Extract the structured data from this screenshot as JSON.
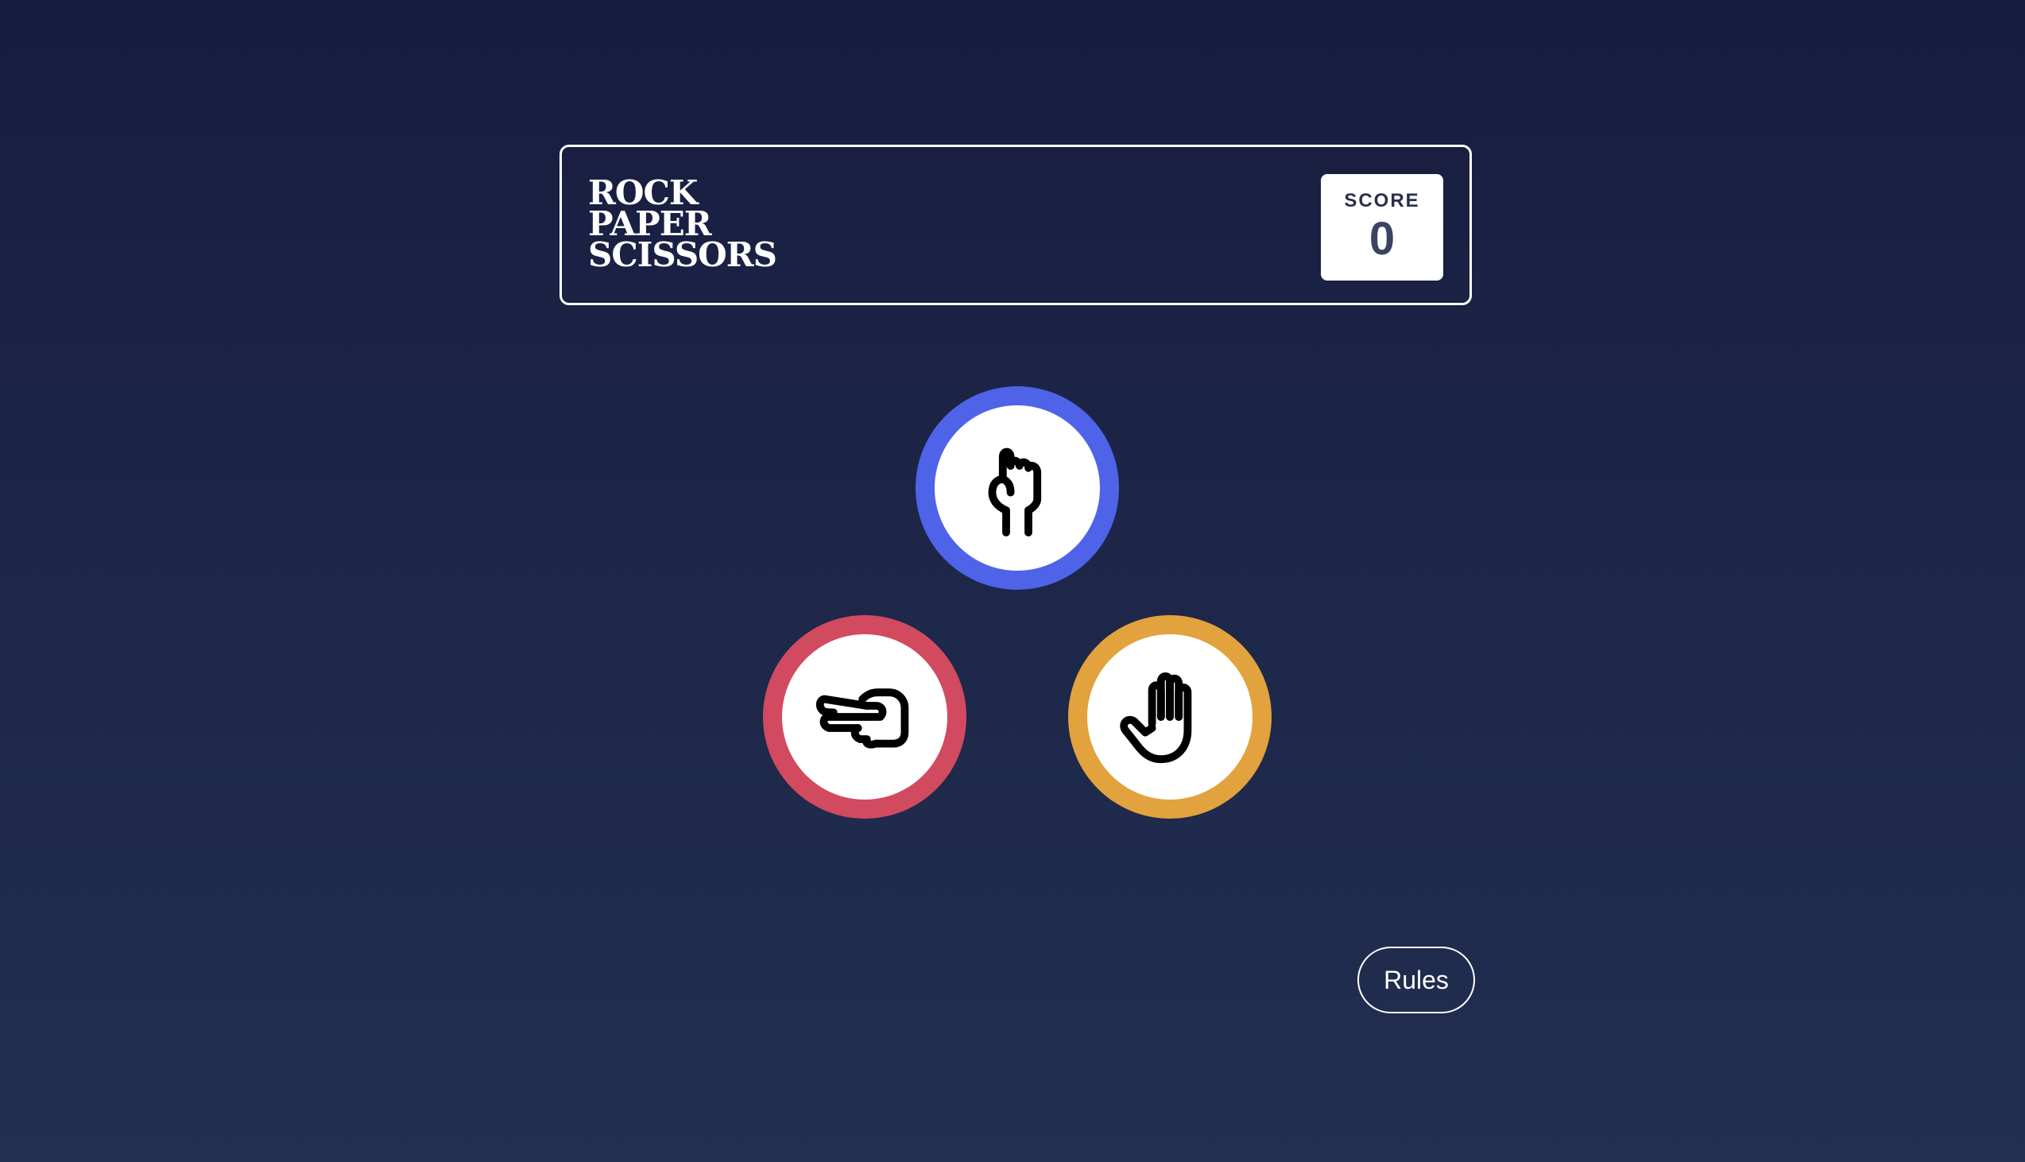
{
  "header": {
    "logo_lines": [
      "Rock",
      "Paper",
      "Scissors"
    ],
    "score_label": "SCORE",
    "score_value": "0"
  },
  "choices": [
    {
      "name": "rock",
      "icon": "rock-hand-icon",
      "color": "#4e63e8"
    },
    {
      "name": "scissors",
      "icon": "scissors-hand-icon",
      "color": "#d24a60"
    },
    {
      "name": "paper",
      "icon": "paper-hand-icon",
      "color": "#e2a23d"
    }
  ],
  "rules_button": {
    "label": "Rules"
  }
}
